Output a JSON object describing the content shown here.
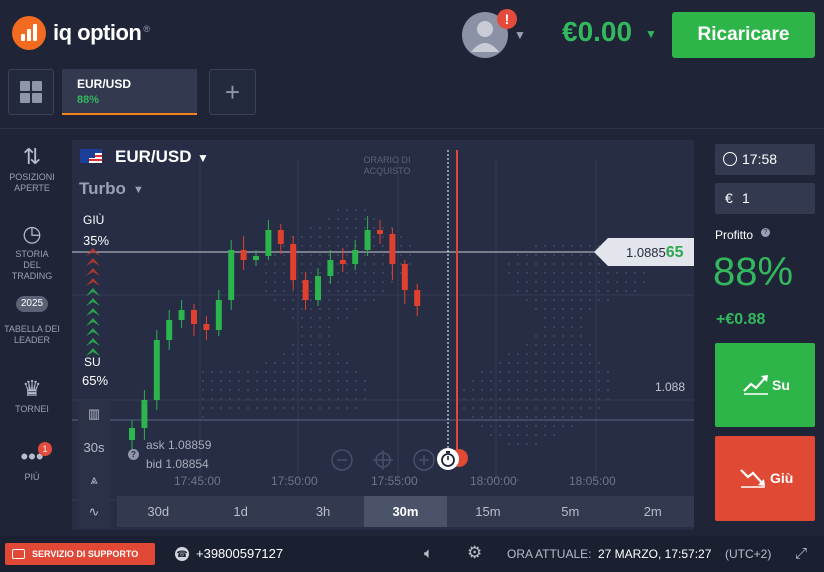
{
  "header": {
    "brand": "iq option",
    "brand_mark": "®",
    "avatar_alert": "!",
    "balance": "€0.00",
    "recharge_label": "Ricaricare"
  },
  "tabs": [
    {
      "symbol": "EUR/USD",
      "payout": "88%"
    }
  ],
  "add_tab": "+",
  "sidebar": {
    "items": [
      {
        "label": "POSIZIONI APERTE",
        "icon": "arrows-up-down-icon"
      },
      {
        "label": "STORIA DEL TRADING",
        "icon": "history-icon"
      },
      {
        "label": "TABELLA DEI LEADER",
        "icon": "laurel-icon",
        "badge": "2025"
      },
      {
        "label": "TORNEI",
        "icon": "trophy-icon"
      },
      {
        "label": "PIÙ",
        "icon": "more-dots-icon",
        "badge": "1"
      }
    ]
  },
  "chart": {
    "asset": "EUR/USD",
    "mode": "Turbo",
    "down_label": "GIÙ",
    "down_pct": "35%",
    "up_label": "SU",
    "up_pct": "65%",
    "purchase_time": "ORARIO DI ACQUISTO",
    "current_price_main": "1.0885",
    "current_price_tail": "65",
    "level_label": "1.088",
    "ask": "ask 1.08859",
    "bid": "bid 1.08854",
    "help": "?",
    "time_labels": [
      "17:45:00",
      "17:50:00",
      "17:55:00",
      "18:00:00",
      "18:05:00"
    ],
    "tool_labels": [
      "30s"
    ],
    "timeframes": [
      "30d",
      "1d",
      "3h",
      "30m",
      "15m",
      "5m",
      "2m"
    ],
    "active_timeframe": "30m"
  },
  "chart_data": {
    "type": "candlestick",
    "ylim": [
      1.0878,
      1.0892
    ],
    "current_price": 1.088565,
    "level": 1.088,
    "candles": [
      {
        "o": 1.0879,
        "c": 1.08796,
        "h": 1.088,
        "l": 1.08784
      },
      {
        "o": 1.08796,
        "c": 1.0881,
        "h": 1.08815,
        "l": 1.0879
      },
      {
        "o": 1.0881,
        "c": 1.0884,
        "h": 1.08845,
        "l": 1.08805
      },
      {
        "o": 1.0884,
        "c": 1.0885,
        "h": 1.08855,
        "l": 1.08835
      },
      {
        "o": 1.0885,
        "c": 1.08855,
        "h": 1.0886,
        "l": 1.08846
      },
      {
        "o": 1.08855,
        "c": 1.08848,
        "h": 1.08858,
        "l": 1.08842
      },
      {
        "o": 1.08848,
        "c": 1.08845,
        "h": 1.08852,
        "l": 1.0884
      },
      {
        "o": 1.08845,
        "c": 1.0886,
        "h": 1.08865,
        "l": 1.08842
      },
      {
        "o": 1.0886,
        "c": 1.08885,
        "h": 1.0889,
        "l": 1.08855
      },
      {
        "o": 1.08885,
        "c": 1.0888,
        "h": 1.08892,
        "l": 1.08875
      },
      {
        "o": 1.0888,
        "c": 1.08882,
        "h": 1.08885,
        "l": 1.08877
      },
      {
        "o": 1.08882,
        "c": 1.08895,
        "h": 1.089,
        "l": 1.0888
      },
      {
        "o": 1.08895,
        "c": 1.08888,
        "h": 1.08898,
        "l": 1.08883
      },
      {
        "o": 1.08888,
        "c": 1.0887,
        "h": 1.08892,
        "l": 1.08865
      },
      {
        "o": 1.0887,
        "c": 1.0886,
        "h": 1.08874,
        "l": 1.08855
      },
      {
        "o": 1.0886,
        "c": 1.08872,
        "h": 1.08876,
        "l": 1.08857
      },
      {
        "o": 1.08872,
        "c": 1.0888,
        "h": 1.08885,
        "l": 1.08868
      },
      {
        "o": 1.0888,
        "c": 1.08878,
        "h": 1.08886,
        "l": 1.08874
      },
      {
        "o": 1.08878,
        "c": 1.08885,
        "h": 1.0889,
        "l": 1.08875
      },
      {
        "o": 1.08885,
        "c": 1.08895,
        "h": 1.08902,
        "l": 1.08882
      },
      {
        "o": 1.08895,
        "c": 1.08893,
        "h": 1.089,
        "l": 1.08888
      },
      {
        "o": 1.08893,
        "c": 1.08878,
        "h": 1.08896,
        "l": 1.0887
      },
      {
        "o": 1.08878,
        "c": 1.08865,
        "h": 1.0888,
        "l": 1.08858
      },
      {
        "o": 1.08865,
        "c": 1.08857,
        "h": 1.08868,
        "l": 1.08852
      }
    ]
  },
  "trade": {
    "time": "17:58",
    "currency": "€",
    "amount": "1",
    "profit_label": "Profitto",
    "profit_pct": "88%",
    "profit_amount": "+€0.88",
    "up_label": "Su",
    "down_label": "Giù"
  },
  "footer": {
    "support": "SERVIZIO DI SUPPORTO",
    "phone": "+39800597127",
    "clock_label": "ORA ATTUALE:",
    "clock_value": "27 MARZO, 17:57:27",
    "timezone": "(UTC+2)"
  },
  "colors": {
    "accent_green": "#2db549",
    "accent_red": "#e04a34",
    "brand_orange": "#f26b21"
  }
}
